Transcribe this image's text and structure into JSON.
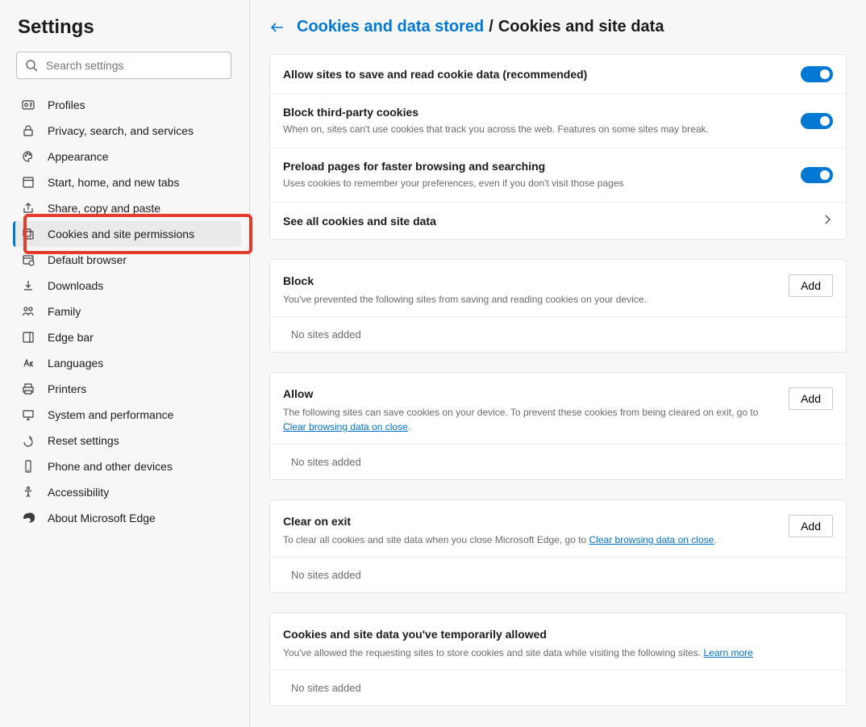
{
  "sidebar": {
    "title": "Settings",
    "search_placeholder": "Search settings",
    "items": [
      {
        "label": "Profiles"
      },
      {
        "label": "Privacy, search, and services"
      },
      {
        "label": "Appearance"
      },
      {
        "label": "Start, home, and new tabs"
      },
      {
        "label": "Share, copy and paste"
      },
      {
        "label": "Cookies and site permissions"
      },
      {
        "label": "Default browser"
      },
      {
        "label": "Downloads"
      },
      {
        "label": "Family"
      },
      {
        "label": "Edge bar"
      },
      {
        "label": "Languages"
      },
      {
        "label": "Printers"
      },
      {
        "label": "System and performance"
      },
      {
        "label": "Reset settings"
      },
      {
        "label": "Phone and other devices"
      },
      {
        "label": "Accessibility"
      },
      {
        "label": "About Microsoft Edge"
      }
    ]
  },
  "breadcrumb": {
    "parent": "Cookies and data stored",
    "sep": "/",
    "current": "Cookies and site data"
  },
  "settings_card": {
    "allow_title": "Allow sites to save and read cookie data (recommended)",
    "block3p_title": "Block third-party cookies",
    "block3p_desc": "When on, sites can't use cookies that track you across the web. Features on some sites may break.",
    "preload_title": "Preload pages for faster browsing and searching",
    "preload_desc": "Uses cookies to remember your preferences, even if you don't visit those pages",
    "see_all": "See all cookies and site data"
  },
  "block_card": {
    "title": "Block",
    "desc": "You've prevented the following sites from saving and reading cookies on your device.",
    "add": "Add",
    "empty": "No sites added"
  },
  "allow_card": {
    "title": "Allow",
    "desc_pre": "The following sites can save cookies on your device. To prevent these cookies from being cleared on exit, go to ",
    "link": "Clear browsing data on close",
    "desc_post": ".",
    "add": "Add",
    "empty": "No sites added"
  },
  "clear_card": {
    "title": "Clear on exit",
    "desc_pre": "To clear all cookies and site data when you close Microsoft Edge, go to ",
    "link": "Clear browsing data on close",
    "desc_post": ".",
    "add": "Add",
    "empty": "No sites added"
  },
  "temp_card": {
    "title": "Cookies and site data you've temporarily allowed",
    "desc_pre": "You've allowed the requesting sites to store cookies and site data while visiting the following sites. ",
    "link": "Learn more",
    "empty": "No sites added"
  }
}
